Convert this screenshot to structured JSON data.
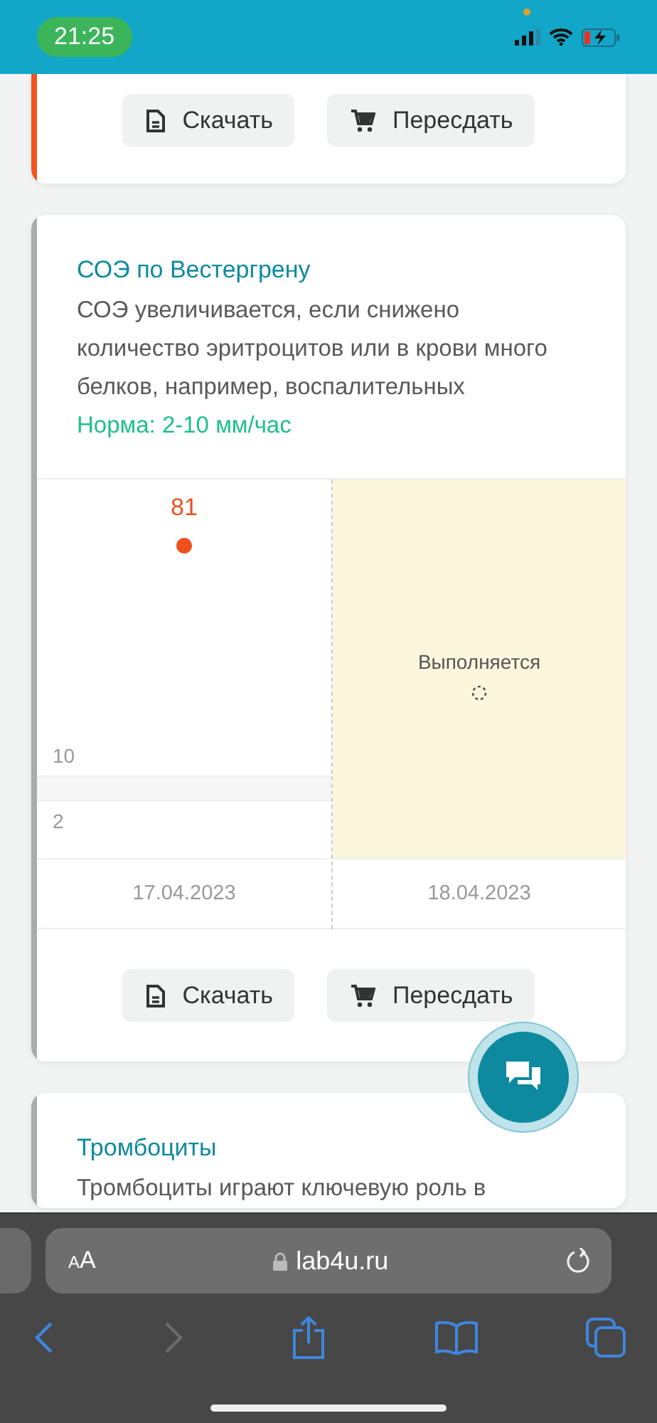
{
  "status_bar": {
    "time": "21:25"
  },
  "cards": [
    {
      "kind": "partial",
      "color": "#f2531f",
      "buttons": [
        {
          "kind": "download",
          "label": "Скачать"
        },
        {
          "kind": "retake",
          "label": "Пересдать"
        }
      ]
    },
    {
      "kind": "full",
      "color": "#a9acad",
      "title": "СОЭ по Вестергрену",
      "description": "СОЭ увеличивается, если снижено количество эритроцитов или в крови много белков, например, воспалительных",
      "norm": "Норма: 2-10 мм/час",
      "chart": {
        "scale_labels": [
          "10",
          "2"
        ],
        "results": [
          {
            "kind": "value",
            "value": "81",
            "date": "17.04.2023",
            "out_of_range": true
          },
          {
            "kind": "pending",
            "status": "Выполняется",
            "date": "18.04.2023"
          }
        ]
      },
      "buttons": [
        {
          "kind": "download",
          "label": "Скачать"
        },
        {
          "kind": "retake",
          "label": "Пересдать"
        }
      ]
    },
    {
      "kind": "cut",
      "color": "#a9acad",
      "title": "Тромбоциты",
      "description": "Тромбоциты играют ключевую роль в"
    }
  ],
  "browser": {
    "text_size": "AA",
    "address": "lab4u.ru",
    "back_enabled": true,
    "forward_enabled": false
  }
}
